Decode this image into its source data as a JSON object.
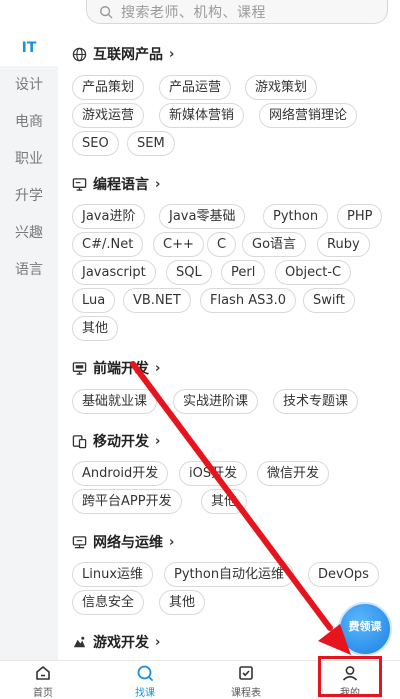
{
  "search": {
    "placeholder": "搜索老师、机构、课程"
  },
  "sidebar": {
    "items": [
      {
        "label": "IT",
        "active": true
      },
      {
        "label": "设计"
      },
      {
        "label": "电商"
      },
      {
        "label": "职业"
      },
      {
        "label": "升学"
      },
      {
        "label": "兴趣"
      },
      {
        "label": "语言"
      }
    ]
  },
  "sections": [
    {
      "title": "互联网产品",
      "icon": "globe-icon",
      "tags": [
        "产品策划",
        "产品运营",
        "游戏策划",
        "游戏运营",
        "新媒体营销",
        "网络营销理论",
        "SEO",
        "SEM"
      ]
    },
    {
      "title": "编程语言",
      "icon": "monitor-icon",
      "tags": [
        "Java进阶",
        "Java零基础",
        "Python",
        "PHP",
        "C#/.Net",
        "C++",
        "C",
        "Go语言",
        "Ruby",
        "Javascript",
        "SQL",
        "Perl",
        "Object-C",
        "Lua",
        "VB.NET",
        "Flash AS3.0",
        "Swift",
        "其他"
      ]
    },
    {
      "title": "前端开发",
      "icon": "code-monitor-icon",
      "tags": [
        "基础就业课",
        "实战进阶课",
        "技术专题课"
      ]
    },
    {
      "title": "移动开发",
      "icon": "devices-icon",
      "tags": [
        "Android开发",
        "iOS开发",
        "微信开发",
        "跨平台APP开发",
        "其他"
      ]
    },
    {
      "title": "网络与运维",
      "icon": "network-icon",
      "tags": [
        "Linux运维",
        "Python自动化运维",
        "DevOps",
        "信息安全",
        "其他"
      ]
    },
    {
      "title": "游戏开发",
      "icon": "game-icon",
      "tags": []
    }
  ],
  "badge": {
    "label": "费领课"
  },
  "tabbar": {
    "items": [
      {
        "label": "首页",
        "icon": "home-icon"
      },
      {
        "label": "找课",
        "icon": "search-icon",
        "active": true
      },
      {
        "label": "课程表",
        "icon": "schedule-icon"
      },
      {
        "label": "我的",
        "icon": "user-icon"
      }
    ]
  },
  "colors": {
    "accent": "#1a8fe3",
    "annotation": "#e8141d",
    "sidebar_bg": "#f3f4f5"
  }
}
